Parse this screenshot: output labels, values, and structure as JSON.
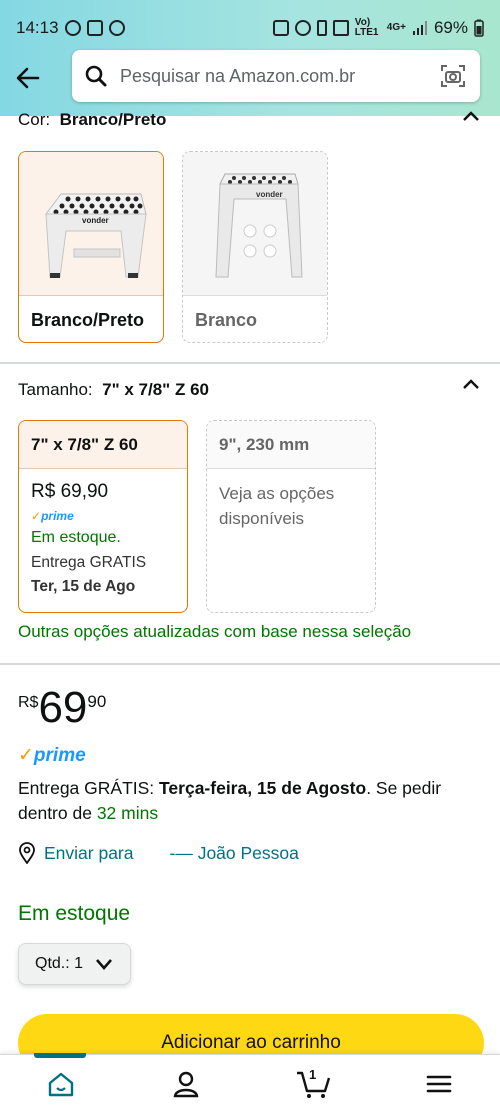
{
  "status_bar": {
    "time": "14:13",
    "battery": "69%",
    "network": "4G+",
    "volte": "Vo) LTE1"
  },
  "search": {
    "placeholder": "Pesquisar na Amazon.com.br"
  },
  "color": {
    "label": "Cor:",
    "selected": "Branco/Preto",
    "options": [
      {
        "label": "Branco/Preto",
        "selected": true,
        "brand": "vonder"
      },
      {
        "label": "Branco",
        "selected": false,
        "brand": "vonder"
      }
    ]
  },
  "size": {
    "label": "Tamanho:",
    "selected": "7\" x 7/8\" Z 60",
    "options": [
      {
        "label": "7\" x 7/8\" Z 60",
        "price": "R$ 69,90",
        "prime": "prime",
        "stock": "Em estoque.",
        "delivery_prefix": "Entrega GRATIS ",
        "delivery_date": "Ter, 15 de Ago"
      },
      {
        "label": "9\", 230 mm",
        "note": "Veja as opções disponíveis"
      }
    ],
    "update_note": "Outras opções atualizadas com base nessa seleção"
  },
  "price": {
    "currency": "R$",
    "integer": "69",
    "cents": "90"
  },
  "prime_label": "prime",
  "delivery": {
    "prefix": "Entrega GRÁTIS: ",
    "date": "Terça-feira, 15 de Agosto",
    "middle": ". Se pedir dentro de ",
    "mins": "32 mins"
  },
  "ship_to": {
    "label": "Enviar para",
    "location": "-— João Pessoa"
  },
  "stock": "Em estoque",
  "quantity": {
    "label": "Qtd.:",
    "value": "1"
  },
  "add_to_cart": "Adicionar ao carrinho",
  "nav": {
    "cart_count": "1"
  },
  "colors": {
    "accent_orange": "#e77600",
    "prime_blue": "#1a98ff",
    "stock_green": "#007600",
    "link_teal": "#007185",
    "cart_yellow": "#ffd814"
  }
}
